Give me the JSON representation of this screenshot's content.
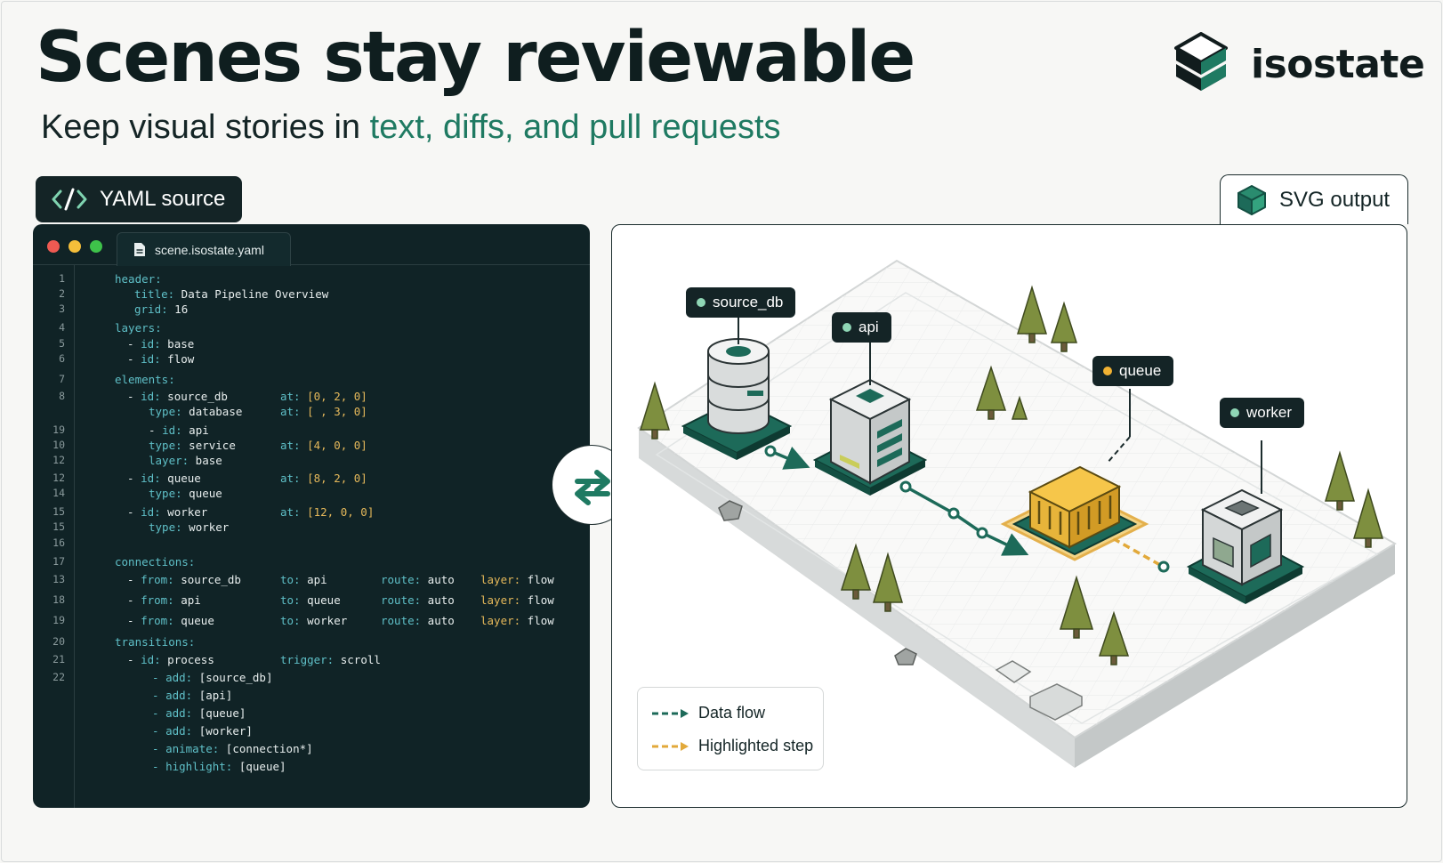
{
  "header": {
    "title": "Scenes stay reviewable",
    "subtitle_plain": "Keep visual stories in ",
    "subtitle_accent": "text, diffs, and pull requests"
  },
  "brand": {
    "name": "isostate",
    "icon": "isostate-logo-icon"
  },
  "yaml_panel": {
    "label": "YAML source",
    "icon": "code-brackets-icon"
  },
  "svg_panel": {
    "label": "SVG output",
    "icon": "cube-icon"
  },
  "editor": {
    "filename": "scene.isostate.yaml",
    "file_icon": "file-icon",
    "lines": [
      {
        "ln": "1",
        "segs": [
          {
            "t": "header:",
            "c": "k"
          }
        ]
      },
      {
        "ln": "2",
        "segs": [
          {
            "t": "title:",
            "c": "k"
          },
          {
            "t": " Data Pipeline Overview",
            "c": "v"
          }
        ]
      },
      {
        "ln": "3",
        "segs": [
          {
            "t": "grid:",
            "c": "k"
          },
          {
            "t": " 16",
            "c": "v"
          }
        ]
      },
      {
        "ln": "4",
        "segs": [
          {
            "t": "layers:",
            "c": "k"
          }
        ]
      },
      {
        "ln": "5",
        "segs": [
          {
            "t": "- ",
            "c": "v"
          },
          {
            "t": "id:",
            "c": "k"
          },
          {
            "t": " base",
            "c": "v"
          }
        ]
      },
      {
        "ln": "6",
        "segs": [
          {
            "t": "- ",
            "c": "v"
          },
          {
            "t": "id:",
            "c": "k"
          },
          {
            "t": " flow",
            "c": "v"
          }
        ]
      },
      {
        "ln": "7",
        "segs": [
          {
            "t": "elements:",
            "c": "k"
          }
        ]
      },
      {
        "ln": "8",
        "segs": [
          {
            "t": "- ",
            "c": "v"
          },
          {
            "t": "id:",
            "c": "k"
          },
          {
            "t": " source_db",
            "c": "v"
          }
        ],
        "extra": [
          {
            "t": "at:",
            "c": "k"
          },
          {
            "t": " [0, 2, 0]",
            "c": "n"
          }
        ]
      },
      {
        "ln": "",
        "segs": [
          {
            "t": "type:",
            "c": "k"
          },
          {
            "t": " database",
            "c": "v"
          }
        ],
        "extra": [
          {
            "t": "at:",
            "c": "k"
          },
          {
            "t": " [ , 3, 0]",
            "c": "n"
          }
        ]
      },
      {
        "ln": "19",
        "segs": [
          {
            "t": "- ",
            "c": "v"
          },
          {
            "t": "id:",
            "c": "k"
          },
          {
            "t": " api",
            "c": "v"
          }
        ]
      },
      {
        "ln": "10",
        "segs": [
          {
            "t": "type:",
            "c": "k"
          },
          {
            "t": " service",
            "c": "v"
          }
        ],
        "extra": [
          {
            "t": "at:",
            "c": "k"
          },
          {
            "t": " [4, 0, 0]",
            "c": "n"
          }
        ]
      },
      {
        "ln": "12",
        "segs": [
          {
            "t": "layer:",
            "c": "k"
          },
          {
            "t": " base",
            "c": "v"
          }
        ]
      },
      {
        "ln": "12",
        "segs": [
          {
            "t": "- ",
            "c": "v"
          },
          {
            "t": "id:",
            "c": "k"
          },
          {
            "t": " queue",
            "c": "v"
          }
        ],
        "extra": [
          {
            "t": "at:",
            "c": "k"
          },
          {
            "t": " [8, 2, 0]",
            "c": "n"
          }
        ]
      },
      {
        "ln": "14",
        "segs": [
          {
            "t": "type:",
            "c": "k"
          },
          {
            "t": " queue",
            "c": "v"
          }
        ]
      },
      {
        "ln": "15",
        "segs": [
          {
            "t": "- ",
            "c": "v"
          },
          {
            "t": "id:",
            "c": "k"
          },
          {
            "t": " worker",
            "c": "v"
          }
        ],
        "extra": [
          {
            "t": "at:",
            "c": "k"
          },
          {
            "t": " [12, 0, 0]",
            "c": "n"
          }
        ]
      },
      {
        "ln": "15",
        "segs": [
          {
            "t": "type:",
            "c": "k"
          },
          {
            "t": " worker",
            "c": "v"
          }
        ]
      },
      {
        "ln": "16",
        "segs": []
      },
      {
        "ln": "17",
        "segs": [
          {
            "t": "connections:",
            "c": "k"
          }
        ]
      },
      {
        "ln": "13",
        "segs": [
          {
            "t": "- ",
            "c": "v"
          },
          {
            "t": "from:",
            "c": "k"
          },
          {
            "t": " source_db",
            "c": "v"
          }
        ],
        "cols": [
          [
            {
              "t": "to:",
              "c": "k"
            },
            {
              "t": " api",
              "c": "v"
            }
          ],
          [
            {
              "t": "route:",
              "c": "k"
            },
            {
              "t": " auto",
              "c": "v"
            }
          ],
          [
            {
              "t": "layer:",
              "c": "n"
            },
            {
              "t": " flow",
              "c": "v"
            }
          ]
        ]
      },
      {
        "ln": "18",
        "segs": [
          {
            "t": "- ",
            "c": "v"
          },
          {
            "t": "from:",
            "c": "k"
          },
          {
            "t": " api",
            "c": "v"
          }
        ],
        "cols": [
          [
            {
              "t": "to:",
              "c": "k"
            },
            {
              "t": " queue",
              "c": "v"
            }
          ],
          [
            {
              "t": "route:",
              "c": "k"
            },
            {
              "t": " auto",
              "c": "v"
            }
          ],
          [
            {
              "t": "layer:",
              "c": "n"
            },
            {
              "t": " flow",
              "c": "v"
            }
          ]
        ]
      },
      {
        "ln": "19",
        "segs": [
          {
            "t": "- ",
            "c": "v"
          },
          {
            "t": "from:",
            "c": "k"
          },
          {
            "t": " queue",
            "c": "v"
          }
        ],
        "cols": [
          [
            {
              "t": "to:",
              "c": "k"
            },
            {
              "t": " worker",
              "c": "v"
            }
          ],
          [
            {
              "t": "route:",
              "c": "k"
            },
            {
              "t": " auto",
              "c": "v"
            }
          ],
          [
            {
              "t": "layer:",
              "c": "n"
            },
            {
              "t": " flow",
              "c": "v"
            }
          ]
        ]
      },
      {
        "ln": "20",
        "segs": [
          {
            "t": "transitions:",
            "c": "k"
          }
        ]
      },
      {
        "ln": "21",
        "segs": [
          {
            "t": "- ",
            "c": "v"
          },
          {
            "t": "id:",
            "c": "k"
          },
          {
            "t": " process",
            "c": "v"
          }
        ],
        "extra": [
          {
            "t": "trigger:",
            "c": "k"
          },
          {
            "t": " scroll",
            "c": "v"
          }
        ]
      },
      {
        "ln": "22",
        "segs": [
          {
            "t": "- ",
            "c": "k"
          },
          {
            "t": "add:",
            "c": "k"
          },
          {
            "t": " [source_db]",
            "c": "v"
          }
        ]
      },
      {
        "ln": "",
        "segs": [
          {
            "t": "- ",
            "c": "k"
          },
          {
            "t": "add:",
            "c": "k"
          },
          {
            "t": " [api]",
            "c": "v"
          }
        ]
      },
      {
        "ln": "",
        "segs": [
          {
            "t": "- ",
            "c": "k"
          },
          {
            "t": "add:",
            "c": "k"
          },
          {
            "t": " [queue]",
            "c": "v"
          }
        ]
      },
      {
        "ln": "",
        "segs": [
          {
            "t": "- ",
            "c": "k"
          },
          {
            "t": "add:",
            "c": "k"
          },
          {
            "t": " [worker]",
            "c": "v"
          }
        ]
      },
      {
        "ln": "",
        "segs": [
          {
            "t": "- ",
            "c": "k"
          },
          {
            "t": "animate:",
            "c": "k"
          },
          {
            "t": " [connection*]",
            "c": "v"
          }
        ]
      },
      {
        "ln": "",
        "segs": [
          {
            "t": "- ",
            "c": "k"
          },
          {
            "t": "highlight:",
            "c": "k"
          },
          {
            "t": " [queue]",
            "c": "v"
          }
        ]
      }
    ]
  },
  "swap_icon": "swap-arrows-icon",
  "scene": {
    "nodes": [
      {
        "id": "source_db",
        "label": "source_db",
        "kind": "database",
        "dot_color": "#8fd6b5"
      },
      {
        "id": "api",
        "label": "api",
        "kind": "service",
        "dot_color": "#8fd6b5"
      },
      {
        "id": "queue",
        "label": "queue",
        "kind": "queue",
        "dot_color": "#f2b233"
      },
      {
        "id": "worker",
        "label": "worker",
        "kind": "worker",
        "dot_color": "#8fd6b5"
      }
    ],
    "colors": {
      "flow": "#1d6a59",
      "highlight": "#e2a93a",
      "accent": "#1f7a62"
    }
  },
  "legend": {
    "items": [
      {
        "label": "Data flow",
        "color": "#1d6a59"
      },
      {
        "label": "Highlighted step",
        "color": "#e2a93a"
      }
    ]
  }
}
